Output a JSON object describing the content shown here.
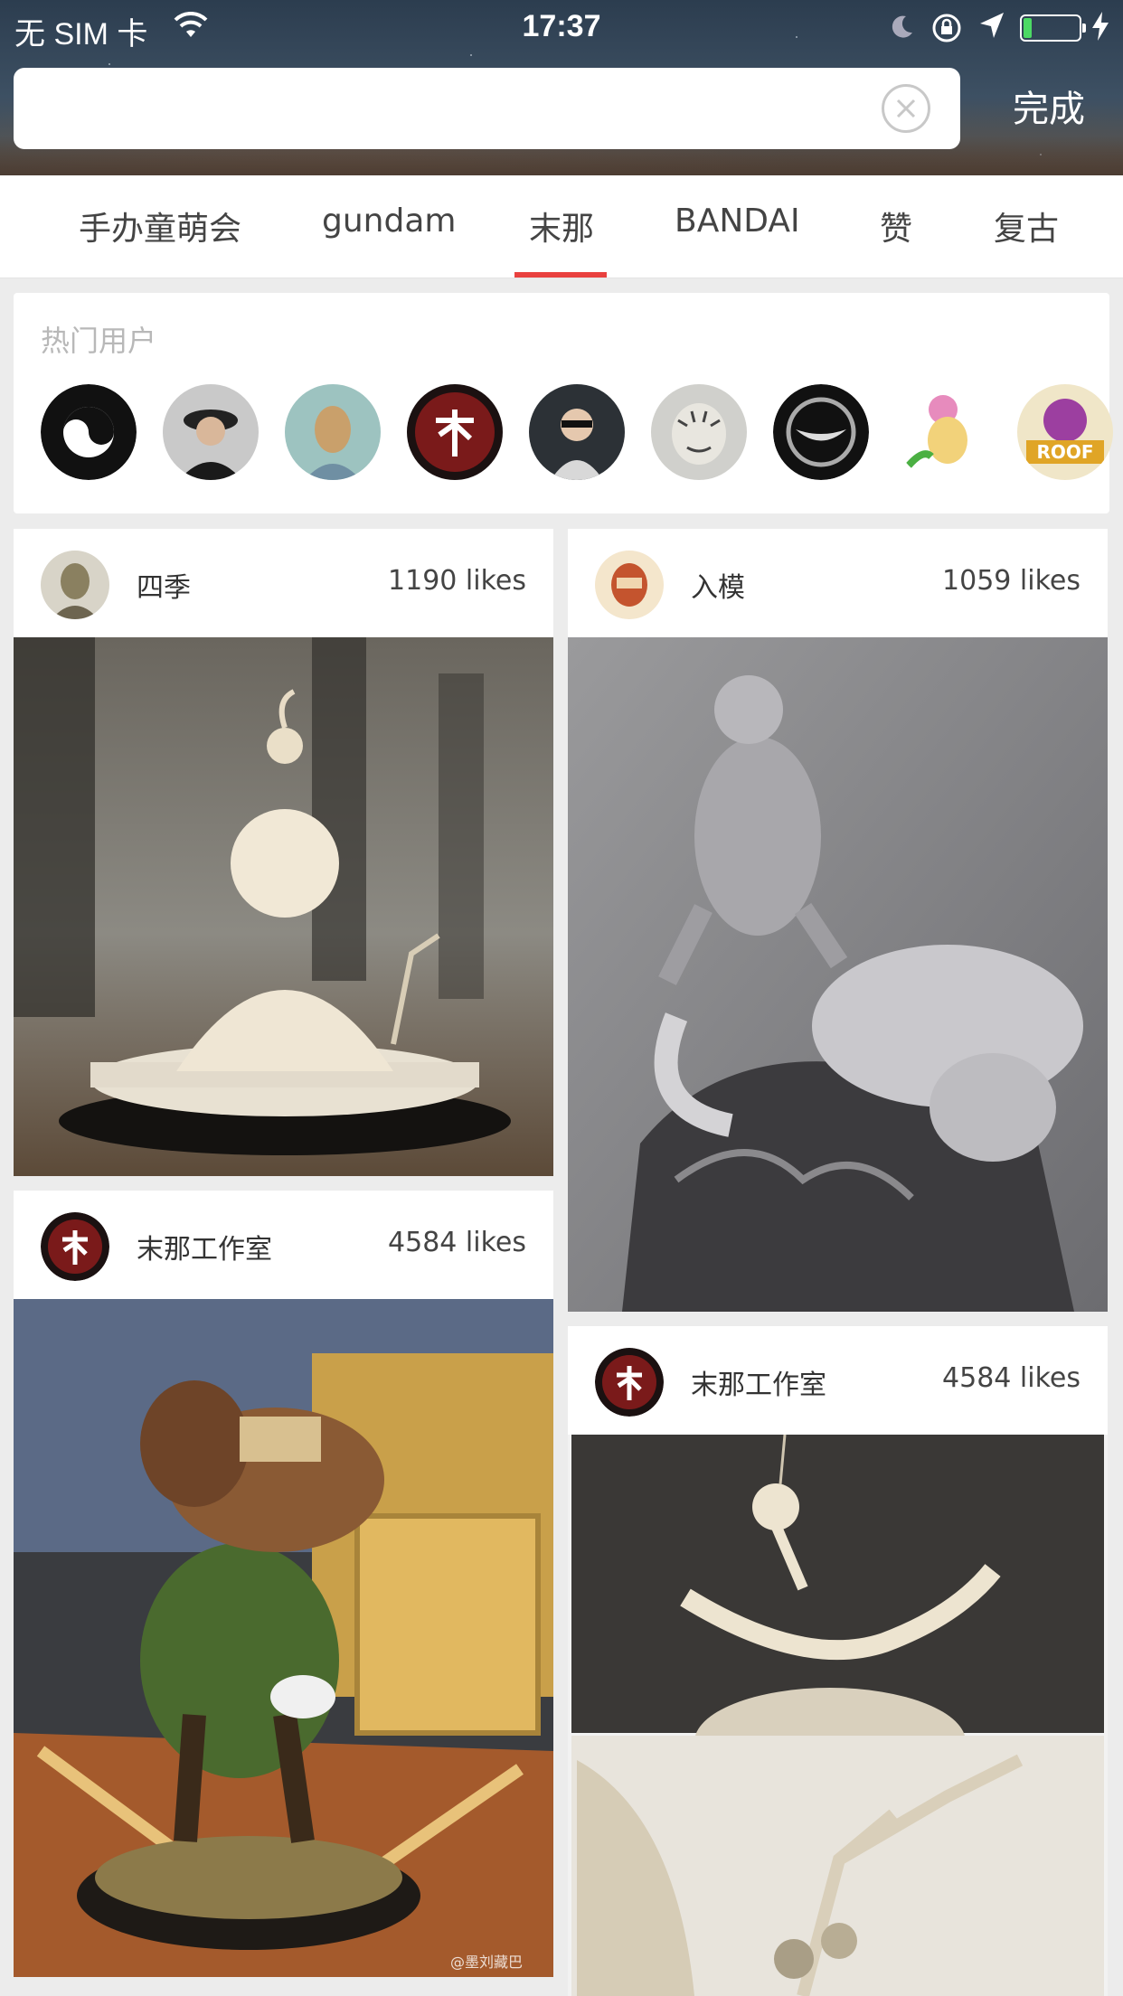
{
  "status_bar": {
    "carrier": "无 SIM 卡",
    "time": "17:37",
    "battery_level": 0.15
  },
  "search": {
    "value": "",
    "placeholder": "",
    "done_label": "完成"
  },
  "tabs": [
    {
      "label": "手办童萌会",
      "active": false
    },
    {
      "label": "gundam",
      "active": false
    },
    {
      "label": "末那",
      "active": true
    },
    {
      "label": "BANDAI",
      "active": false
    },
    {
      "label": "赞",
      "active": false
    },
    {
      "label": "复古",
      "active": false
    }
  ],
  "hot_users": {
    "title": "热门用户",
    "avatar_icons": [
      "yin-yang-avatar",
      "man-in-hat-avatar",
      "van-gogh-avatar",
      "mona-models-avatar",
      "aviator-avatar",
      "tiger-avatar",
      "emblem-avatar",
      "cartoon-flower-avatar",
      "roof-character-avatar"
    ]
  },
  "feed": [
    {
      "user": "四季",
      "likes": "1190 likes",
      "photo": "ivory figurine of child sitting on pedestal"
    },
    {
      "user": "入模",
      "likes": "1059 likes",
      "photo": "monochrome sculpture of man riding leopard on rock"
    },
    {
      "user": "末那工作室",
      "likes": "4584 likes",
      "photo": "painted cartoon mouse figure on base",
      "caption": "@墨刘藏巴"
    },
    {
      "user": "末那工作室",
      "likes": "4584 likes",
      "photo": "ivory carved figurines detail"
    }
  ],
  "colors": {
    "accent": "#e9413f",
    "background": "#ececec"
  }
}
